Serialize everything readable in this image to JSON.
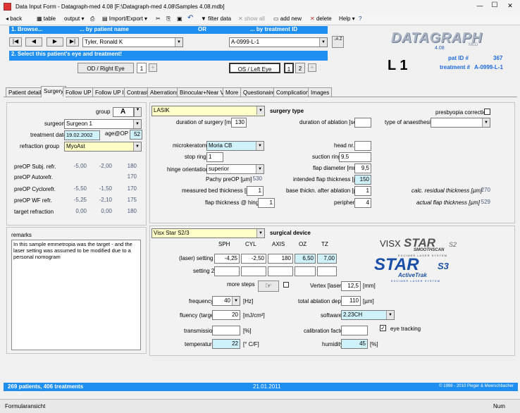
{
  "window": {
    "title": "Data Input Form - Datagraph-med 4.08 [F:\\Datagraph-med 4.08\\Samples 4.08.mdb]",
    "min": "—",
    "max": "☐",
    "close": "✕"
  },
  "toolbar": {
    "back": "back",
    "table": "table",
    "output": "output",
    "import_export": "Import/Export",
    "undo": "↶",
    "filter": "filter data",
    "show_all": "show all",
    "add_new": "add new",
    "delete": "delete",
    "help": "Help"
  },
  "browse": {
    "label": "1. Browse...",
    "by_name": "... by patient name",
    "or": "OR",
    "by_treatment": "... by treatment ID",
    "patient": "Tyler, Ronald K",
    "treatment": "A-0999-L-1",
    "nav_first": "|◀",
    "nav_prev": "◀",
    "nav_next": "▶",
    "nav_last": "▶|",
    "sort": "↓A Z"
  },
  "logo": {
    "name": "DATAGRAPH",
    "version": "4.08",
    "med": "MED"
  },
  "select": {
    "label": "2. Select this patient's eye and treatment!",
    "od": "OD / Right Eye",
    "od_num": "1",
    "plus": "+",
    "os": "OS / Left Eye",
    "os_num1": "1",
    "os_num2": "2"
  },
  "header": {
    "code": "L 1",
    "pat_label": "pat ID #",
    "pat_id": "367",
    "treat_label": "treatment #",
    "treat_id": "A-0999-L-1"
  },
  "tabs": [
    "Patient details",
    "Surgery",
    "Follow UP I",
    "Follow UP II",
    "Contrast",
    "Aberrations",
    "Binocular+Near VA",
    "More",
    "Questionaire",
    "Complications",
    "Images"
  ],
  "left": {
    "group_label": "group",
    "group": "A",
    "surgeon_label": "surgeon",
    "surgeon": "Surgeon 1",
    "date_label": "treatment date",
    "date": "19.02.2002",
    "age_label": "age@OP",
    "age": "52",
    "refgroup_label": "refraction group",
    "refgroup": "MyoAst",
    "rows": [
      {
        "label": "preOP Subj. refr.",
        "a": "-5,00",
        "b": "-2,00",
        "c": "180"
      },
      {
        "label": "preOP Autorefr.",
        "a": "",
        "b": "",
        "c": "170"
      },
      {
        "label": "preOP Cyclorefr.",
        "a": "-5,50",
        "b": "-1,50",
        "c": "170"
      },
      {
        "label": "preOP WF refr.",
        "a": "-5,25",
        "b": "-2,10",
        "c": "175"
      },
      {
        "label": "target refraction",
        "a": "0,00",
        "b": "0,00",
        "c": "180"
      }
    ],
    "remarks_label": "remarks",
    "remarks": "In this sample emmetropia was the target - and the laser setting was assumed to be modified due to a personal nomogram"
  },
  "surgery": {
    "type": "LASIK",
    "type_label": "surgery type",
    "presbyopia": "presbyopia correction",
    "dur_label": "duration of surgery [min]",
    "dur": "130",
    "abl_label": "duration of ablation [sec]",
    "abl": "",
    "anaes_label": "type of anaesthesia",
    "anaes": "",
    "micro_label": "microkeratome",
    "micro": "Moria CB",
    "head_label": "head nr.",
    "head": "",
    "stop_label": "stop ring",
    "stop": "1",
    "suction_label": "suction ring",
    "suction": "9.5",
    "hinge_label": "hinge orientation",
    "hinge": "superior",
    "flapd_label": "flap diameter [mm]",
    "flapd": "9,5",
    "pachy_label": "Pachy preOP [µm]",
    "pachy": "530",
    "ift_label": "intended flap thickness [µm]",
    "ift": "150",
    "bed_label": "measured bed thickness [µm]",
    "bed": "1",
    "base_label": "base thickn. after ablation [µm]",
    "base": "1",
    "calc_label": "calc. residual thickness [µm]",
    "calc": "270",
    "fth_label": "flap thickness @ hinge",
    "fth": "1",
    "peri_label": "peripher",
    "peri": "4",
    "act_label": "actual flap thickness [µm]",
    "act": "529"
  },
  "device": {
    "name": "Visx Star S2/3",
    "label": "surgical device",
    "cols": [
      "SPH",
      "CYL",
      "AXIS",
      "OZ",
      "TZ"
    ],
    "s1_label": "(laser) setting 1",
    "s1": [
      "-4,25",
      "-2,50",
      "180",
      "6,50",
      "7,00"
    ],
    "s2_label": "setting 2",
    "s2": [
      "",
      "",
      "",
      "",
      ""
    ],
    "more_label": "more steps",
    "vertex_label": "Vertex [laser]",
    "vertex": "12,5",
    "vertex_unit": "[mm]",
    "freq_label": "frequency",
    "freq": "40",
    "freq_unit": "[Hz]",
    "tad_label": "total ablation depth",
    "tad": "110",
    "tad_unit": "[µm]",
    "flu_label": "fluency (target)",
    "flu": "20",
    "flu_unit": "[mJ/cm²]",
    "sw_label": "software",
    "sw": "2.23CH",
    "trans_label": "transmission",
    "trans": "",
    "trans_unit": "[%]",
    "cal_label": "calibration factor",
    "cal": "",
    "eye_label": "eye tracking",
    "temp_label": "temperature",
    "temp": "22",
    "temp_unit": "[° C/F]",
    "hum_label": "humidity",
    "hum": "45",
    "hum_unit": "[%]",
    "logo1": "VISX",
    "logo2": "STAR",
    "logo3": "SMOOTHSCAN",
    "logo4": "EXCIMER LASER SYSTEM",
    "logo5": "STAR",
    "logo6": "ActiveTrak",
    "logo7": "EXCIMER LASER SYSTEM",
    "logo_s2": "S2",
    "logo_s3": "S3"
  },
  "status": {
    "count": "269 patients, 406 treatments",
    "date": "21.01.2011",
    "copyright": "© 1998 - 2010 Pieger & Meerschbacher"
  },
  "bottom": {
    "form": "Formularansicht",
    "num": "Num"
  }
}
